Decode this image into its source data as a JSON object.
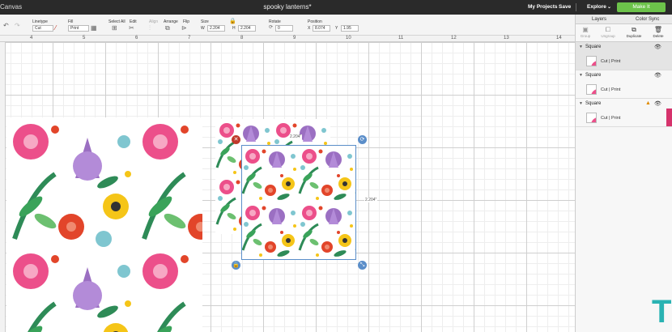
{
  "titlebar": {
    "app_name": "Canvas",
    "doc_title": "spooky lanterns*",
    "my_projects": "My Projects",
    "save": "Save",
    "explore": "Explore",
    "make": "Make It"
  },
  "toolbar": {
    "linetype_label": "Linetype",
    "linetype_value": "Cut",
    "fill_label": "Fill",
    "fill_value": "Print",
    "select_all_label": "Select All",
    "edit_label": "Edit",
    "align_label": "Align",
    "arrange_label": "Arrange",
    "flip_label": "Flip",
    "size_label": "Size",
    "w_label": "W",
    "w_value": "2.204",
    "h_label": "H",
    "h_value": "2.204",
    "rotate_label": "Rotate",
    "rotate_value": "0",
    "position_label": "Position",
    "x_label": "X",
    "x_value": "8.074",
    "y_label": "Y",
    "y_value": "1.95"
  },
  "ruler": {
    "numbers": [
      "4",
      "5",
      "6",
      "7",
      "8",
      "9",
      "10",
      "11",
      "12",
      "13",
      "14"
    ]
  },
  "canvas": {
    "width_dim": "2.204\"",
    "height_dim": "2.204\""
  },
  "panel": {
    "tabs": [
      "Layers",
      "Color Sync"
    ],
    "actions": [
      "Group",
      "Ungroup",
      "Duplicate",
      "Delete"
    ],
    "layers": [
      {
        "name": "Square",
        "op": "Cut | Print",
        "warning": false
      },
      {
        "name": "Square",
        "op": "Cut | Print",
        "warning": false
      },
      {
        "name": "Square",
        "op": "Cut | Print",
        "warning": true
      }
    ]
  },
  "brand_text": "T",
  "colors": {
    "make_button": "#6cc24a",
    "accent_pink": "#d6336c",
    "handle_delete": "#c0392b",
    "handle_blue": "#5b8ec9",
    "brand": "#2ab3b3"
  }
}
